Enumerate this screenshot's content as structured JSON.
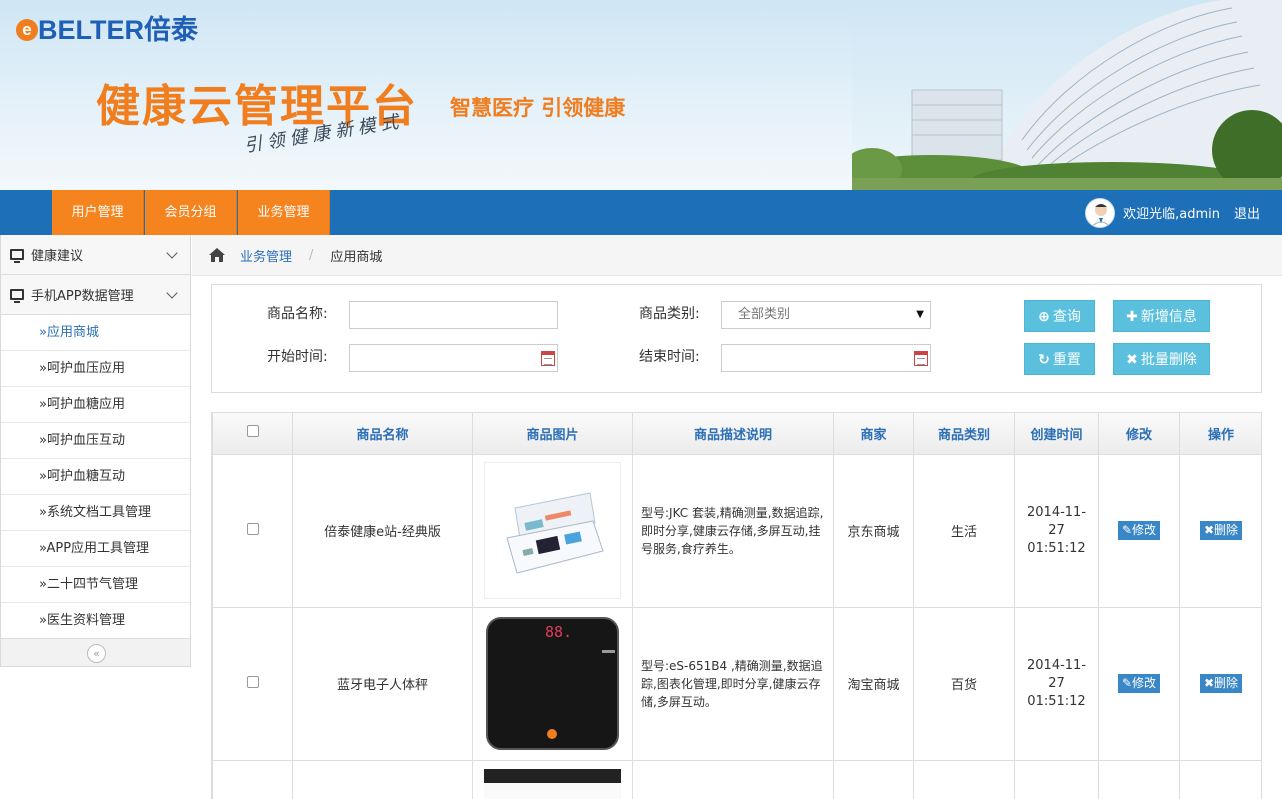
{
  "header": {
    "logo_text": "BELTER倍泰",
    "logo_e": "e",
    "title": "健康云管理平台",
    "slogan": "智慧医疗   引领健康",
    "subtitle": "引领健康新模式"
  },
  "nav": {
    "tabs": [
      {
        "label": "用户管理"
      },
      {
        "label": "会员分组"
      },
      {
        "label": "业务管理"
      }
    ],
    "welcome": "欢迎光临,admin",
    "logout": "退出"
  },
  "sidebar": {
    "groups": [
      {
        "label": "健康建议"
      },
      {
        "label": "手机APP数据管理"
      }
    ],
    "items": [
      {
        "label": "»应用商城"
      },
      {
        "label": "»呵护血压应用"
      },
      {
        "label": "»呵护血糖应用"
      },
      {
        "label": "»呵护血压互动"
      },
      {
        "label": "»呵护血糖互动"
      },
      {
        "label": "»系统文档工具管理"
      },
      {
        "label": "»APP应用工具管理"
      },
      {
        "label": "»二十四节气管理"
      },
      {
        "label": "»医生资料管理"
      }
    ],
    "collapse": "«"
  },
  "breadcrumb": {
    "parent": "业务管理",
    "separator": "/",
    "current": "应用商城"
  },
  "search": {
    "name_label": "商品名称:",
    "name_value": "",
    "category_label": "商品类别:",
    "category_value": "全部类别",
    "start_label": "开始时间:",
    "end_label": "结束时间:",
    "query_btn": "查询",
    "add_btn": "新增信息",
    "reset_btn": "重置",
    "batch_delete_btn": "批量删除"
  },
  "table": {
    "headers": [
      "商品名称",
      "商品图片",
      "商品描述说明",
      "商家",
      "商品类别",
      "创建时间",
      "修改",
      "操作"
    ],
    "rows": [
      {
        "name": "倍泰健康e站-经典版",
        "description": "型号:JKC 套装,精确测量,数据追踪,即时分享,健康云存储,多屏互动,挂号服务,食疗养生。",
        "merchant": "京东商城",
        "category": "生活",
        "created": "2014-11-27 01:51:12",
        "edit": "修改",
        "delete": "删除"
      },
      {
        "name": "蓝牙电子人体秤",
        "description": "型号:eS-651B4 ,精确测量,数据追踪,图表化管理,即时分享,健康云存储,多屏互动。",
        "merchant": "淘宝商城",
        "category": "百货",
        "created": "2014-11-27 01:51:12",
        "edit": "修改",
        "delete": "删除",
        "scale_display": "88."
      }
    ]
  },
  "colors": {
    "orange": "#f5841f",
    "blue": "#1d6fb8",
    "link": "#2b6fb6",
    "info_button": "#5bc0de"
  }
}
